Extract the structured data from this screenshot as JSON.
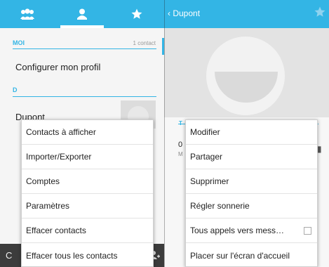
{
  "left": {
    "tabs": [
      {
        "icon": "groups-icon"
      },
      {
        "icon": "person-icon",
        "selected": true
      },
      {
        "icon": "star-icon"
      }
    ],
    "moi_header": "MOI",
    "contact_count": "1 contact",
    "configure_profile": "Configurer mon profil",
    "letter_header": "D",
    "contact_name": "Dupont",
    "bottom_bar_letter": "C",
    "overflow_menu": [
      "Contacts à afficher",
      "Importer/Exporter",
      "Comptes",
      "Paramètres",
      "Effacer contacts",
      "Effacer tous les contacts"
    ]
  },
  "right": {
    "back_title": "‹ Dupont",
    "detail_header": "T",
    "detail_number": "0",
    "detail_sub": "M",
    "context_menu": [
      "Modifier",
      "Partager",
      "Supprimer",
      "Régler sonnerie",
      "Tous appels vers mess…",
      "Placer sur l'écran d'accueil"
    ],
    "voicemail_checked": false
  },
  "colors": {
    "accent": "#33b5e5",
    "bottom_bar": "#3c3c3c"
  }
}
